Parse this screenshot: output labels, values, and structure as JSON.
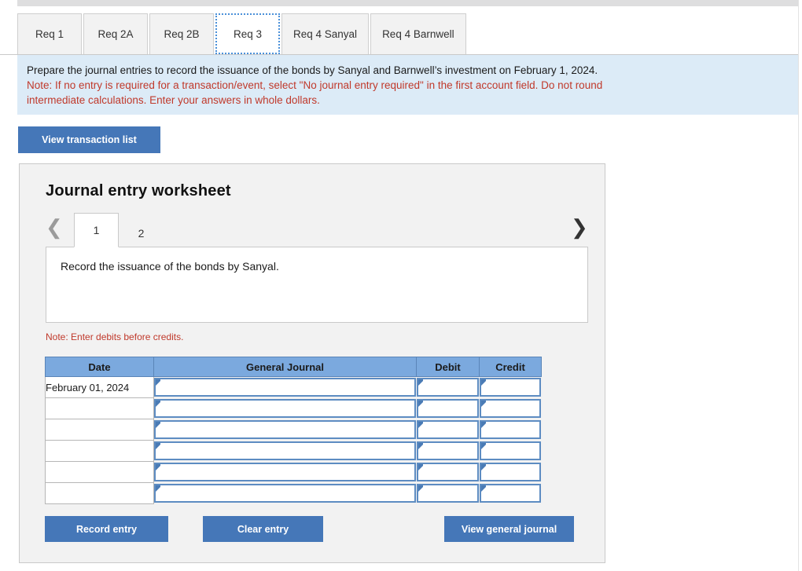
{
  "tabs": [
    {
      "label": "Req 1",
      "active": false
    },
    {
      "label": "Req 2A",
      "active": false
    },
    {
      "label": "Req 2B",
      "active": false
    },
    {
      "label": "Req 3",
      "active": true
    },
    {
      "label": "Req 4 Sanyal",
      "active": false
    },
    {
      "label": "Req 4 Barnwell",
      "active": false
    }
  ],
  "instructions": {
    "line1": "Prepare the journal entries to record the issuance of the bonds by Sanyal and Barnwell’s investment on February 1, 2024.",
    "note_line1": "Note: If no entry is required for a transaction/event, select \"No journal entry required\" in the first account field. Do not round",
    "note_line2": "intermediate calculations. Enter your answers in whole dollars."
  },
  "toolbar": {
    "view_transaction_list_label": "View transaction list"
  },
  "worksheet": {
    "title": "Journal entry worksheet",
    "prev_icon": "chevron-left-icon",
    "next_icon": "chevron-right-icon",
    "entry_tabs": [
      {
        "label": "1",
        "active": true
      },
      {
        "label": "2",
        "active": false
      }
    ],
    "description": "Record the issuance of the bonds by Sanyal.",
    "note": "Note: Enter debits before credits."
  },
  "journal_table": {
    "columns": [
      "Date",
      "General Journal",
      "Debit",
      "Credit"
    ],
    "rows": [
      {
        "date": "February 01, 2024",
        "general_journal": "",
        "debit": "",
        "credit": ""
      },
      {
        "date": "",
        "general_journal": "",
        "debit": "",
        "credit": ""
      },
      {
        "date": "",
        "general_journal": "",
        "debit": "",
        "credit": ""
      },
      {
        "date": "",
        "general_journal": "",
        "debit": "",
        "credit": ""
      },
      {
        "date": "",
        "general_journal": "",
        "debit": "",
        "credit": ""
      },
      {
        "date": "",
        "general_journal": "",
        "debit": "",
        "credit": ""
      }
    ]
  },
  "actions": {
    "record_entry_label": "Record entry",
    "clear_entry_label": "Clear entry",
    "view_general_journal_label": "View general journal"
  },
  "colors": {
    "button_blue": "#4577b8",
    "table_header_blue": "#7ba9de",
    "instruction_bg": "#dcebf7",
    "note_red": "#c0392b",
    "panel_bg": "#f2f2f2",
    "field_border_blue": "#5d8cc2"
  }
}
